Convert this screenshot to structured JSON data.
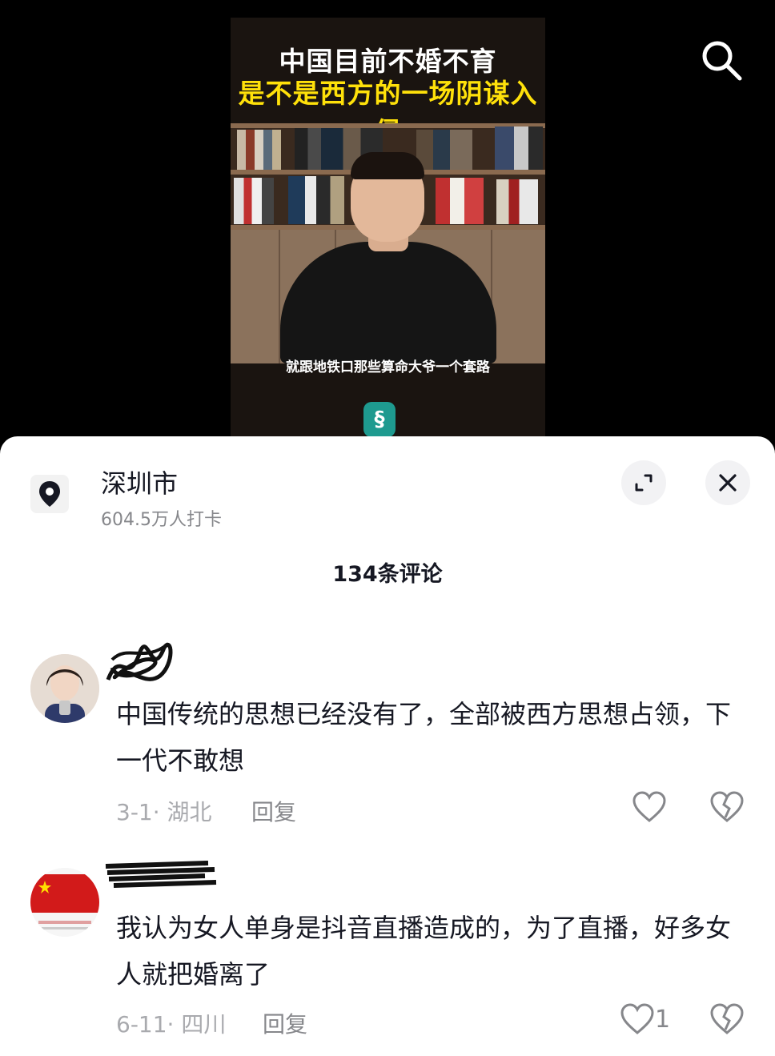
{
  "video": {
    "title_line1": "中国目前不婚不育",
    "title_line2": "是不是西方的一场阴谋入侵",
    "subtitle": "就跟地铁口那些算命大爷一个套路",
    "logo_text": "§"
  },
  "location": {
    "name": "深圳市",
    "checkins": "604.5万人打卡"
  },
  "comments_header": "134条评论",
  "comments": [
    {
      "text": "中国传统的思想已经没有了，全部被西方思想占领，下一代不敢想",
      "date_region": "3-1· 湖北",
      "reply_label": "回复",
      "likes": ""
    },
    {
      "text": "我认为女人单身是抖音直播造成的，为了直播，好多女人就把婚离了",
      "date_region": "6-11· 四川",
      "reply_label": "回复",
      "likes": "1"
    }
  ],
  "colors": {
    "title_yellow": "#ffe10a",
    "sheet_bg": "#ffffff",
    "primary_text": "#161823",
    "secondary_text": "#86878b"
  },
  "icons": [
    "search-icon",
    "location-pin-icon",
    "expand-icon",
    "close-icon",
    "heart-icon",
    "broken-heart-icon"
  ]
}
